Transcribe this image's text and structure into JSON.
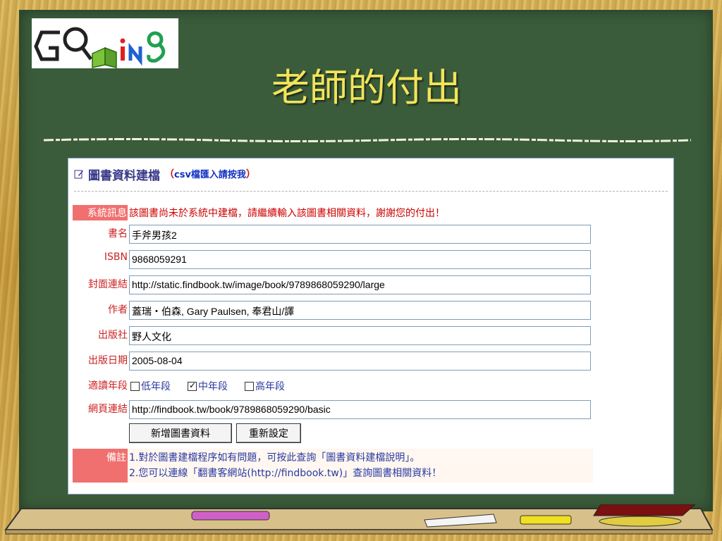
{
  "slide": {
    "title": "老師的付出",
    "logo_text": "ing"
  },
  "panel": {
    "heading": "圖書資料建檔",
    "link_open": "（",
    "link_text": "csv檔匯入請按我",
    "link_close": "）"
  },
  "system_message": {
    "label": "系統訊息",
    "text": "該圖書尚未於系統中建檔，請繼續輸入該圖書相關資料，謝謝您的付出！"
  },
  "fields": {
    "title": {
      "label": "書名",
      "value": "手斧男孩2"
    },
    "isbn": {
      "label": "ISBN",
      "value": "9868059291"
    },
    "cover_url": {
      "label": "封面連結",
      "value": "http://static.findbook.tw/image/book/9789868059290/large"
    },
    "author": {
      "label": "作者",
      "value": "蓋瑞・伯森, Gary Paulsen, 奉君山/譯"
    },
    "publisher": {
      "label": "出版社",
      "value": "野人文化"
    },
    "pub_date": {
      "label": "出版日期",
      "value": "2005-08-04"
    },
    "reading_level": {
      "label": "適讀年段",
      "options": [
        {
          "label": "低年段",
          "checked": false
        },
        {
          "label": "中年段",
          "checked": true
        },
        {
          "label": "高年段",
          "checked": false
        }
      ]
    },
    "web_url": {
      "label": "網頁連結",
      "value": "http://findbook.tw/book/9789868059290/basic"
    }
  },
  "buttons": {
    "submit": "新增圖書資料",
    "reset": "重新設定"
  },
  "notes": {
    "label": "備註",
    "line1": "1.對於圖書建檔程序如有問題，可按此查詢「圖書資料建檔說明」。",
    "line2": "2.您可以連線「翻書客網站(http://findbook.tw)」查詢圖書相關資料！"
  },
  "colors": {
    "board": "#3a5c3a",
    "title": "#f2e35a",
    "label_red": "#cc2222",
    "accent_bg": "#f07070"
  }
}
